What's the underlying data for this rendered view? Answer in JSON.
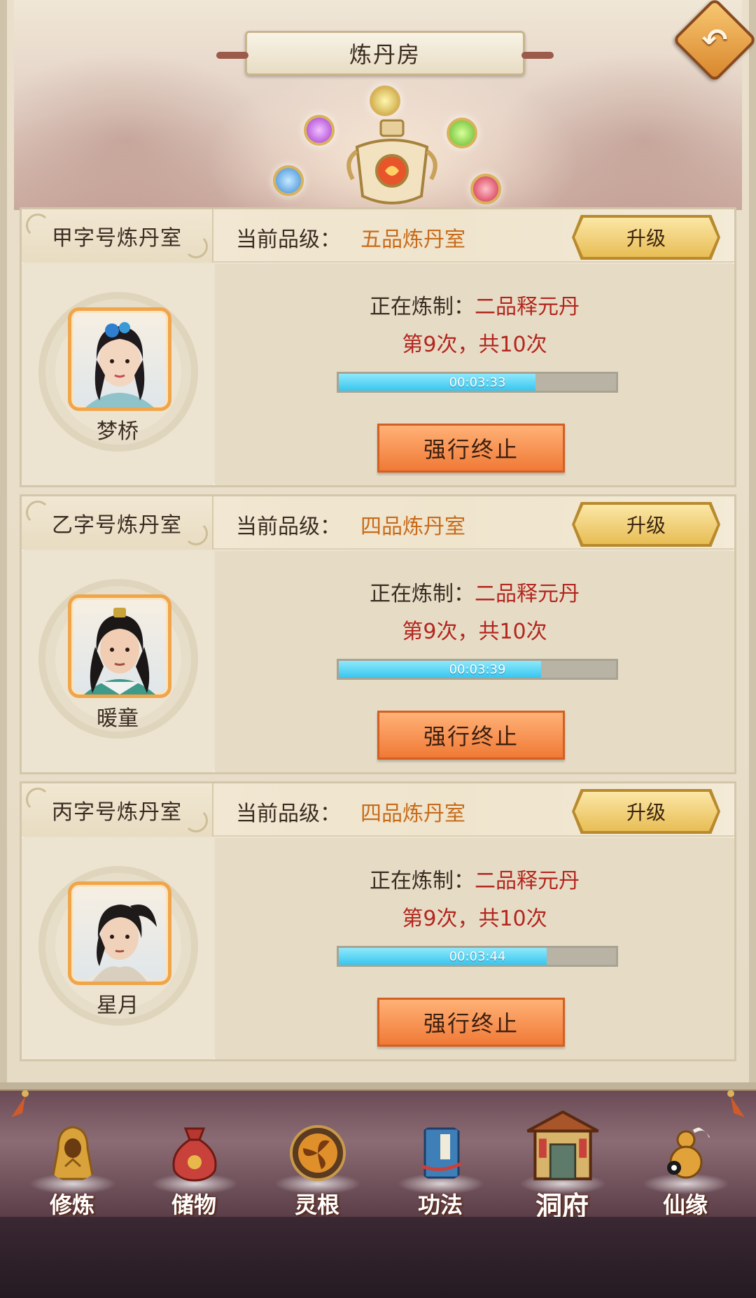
{
  "header": {
    "title": "炼丹房",
    "back_label": "↶"
  },
  "chambers": [
    {
      "room": "甲字号炼丹室",
      "grade_label": "当前品级：",
      "grade": "五品炼丹室",
      "upgrade": "升级",
      "character": "梦桥",
      "brewing_label": "正在炼制：",
      "brewing": "二品释元丹",
      "count": "第9次，共10次",
      "timer": "00:03:33",
      "progress": 0.71,
      "stop": "强行终止"
    },
    {
      "room": "乙字号炼丹室",
      "grade_label": "当前品级：",
      "grade": "四品炼丹室",
      "upgrade": "升级",
      "character": "暖童",
      "brewing_label": "正在炼制：",
      "brewing": "二品释元丹",
      "count": "第9次，共10次",
      "timer": "00:03:39",
      "progress": 0.73,
      "stop": "强行终止"
    },
    {
      "room": "丙字号炼丹室",
      "grade_label": "当前品级：",
      "grade": "四品炼丹室",
      "upgrade": "升级",
      "character": "星月",
      "brewing_label": "正在炼制：",
      "brewing": "二品释元丹",
      "count": "第9次，共10次",
      "timer": "00:03:44",
      "progress": 0.75,
      "stop": "强行终止"
    }
  ],
  "nav": [
    {
      "label": "修炼",
      "icon": "golden-monk-icon",
      "color": "#d9a23a"
    },
    {
      "label": "储物",
      "icon": "treasure-bag-icon",
      "color": "#c8413a"
    },
    {
      "label": "灵根",
      "icon": "triskelion-icon",
      "color": "#e0902a"
    },
    {
      "label": "功法",
      "icon": "scripture-book-icon",
      "color": "#3f7fb8"
    },
    {
      "label": "洞府",
      "icon": "cave-mansion-icon",
      "color": "#7a8a5a"
    },
    {
      "label": "仙缘",
      "icon": "gourd-icon",
      "color": "#e2a23a"
    }
  ],
  "colors": {
    "grade": "#c86b1a",
    "pill": "#b3261e",
    "progress": "#39c6ef",
    "stop_button": "#f07a36",
    "upgrade_button": "#e8bd55"
  }
}
